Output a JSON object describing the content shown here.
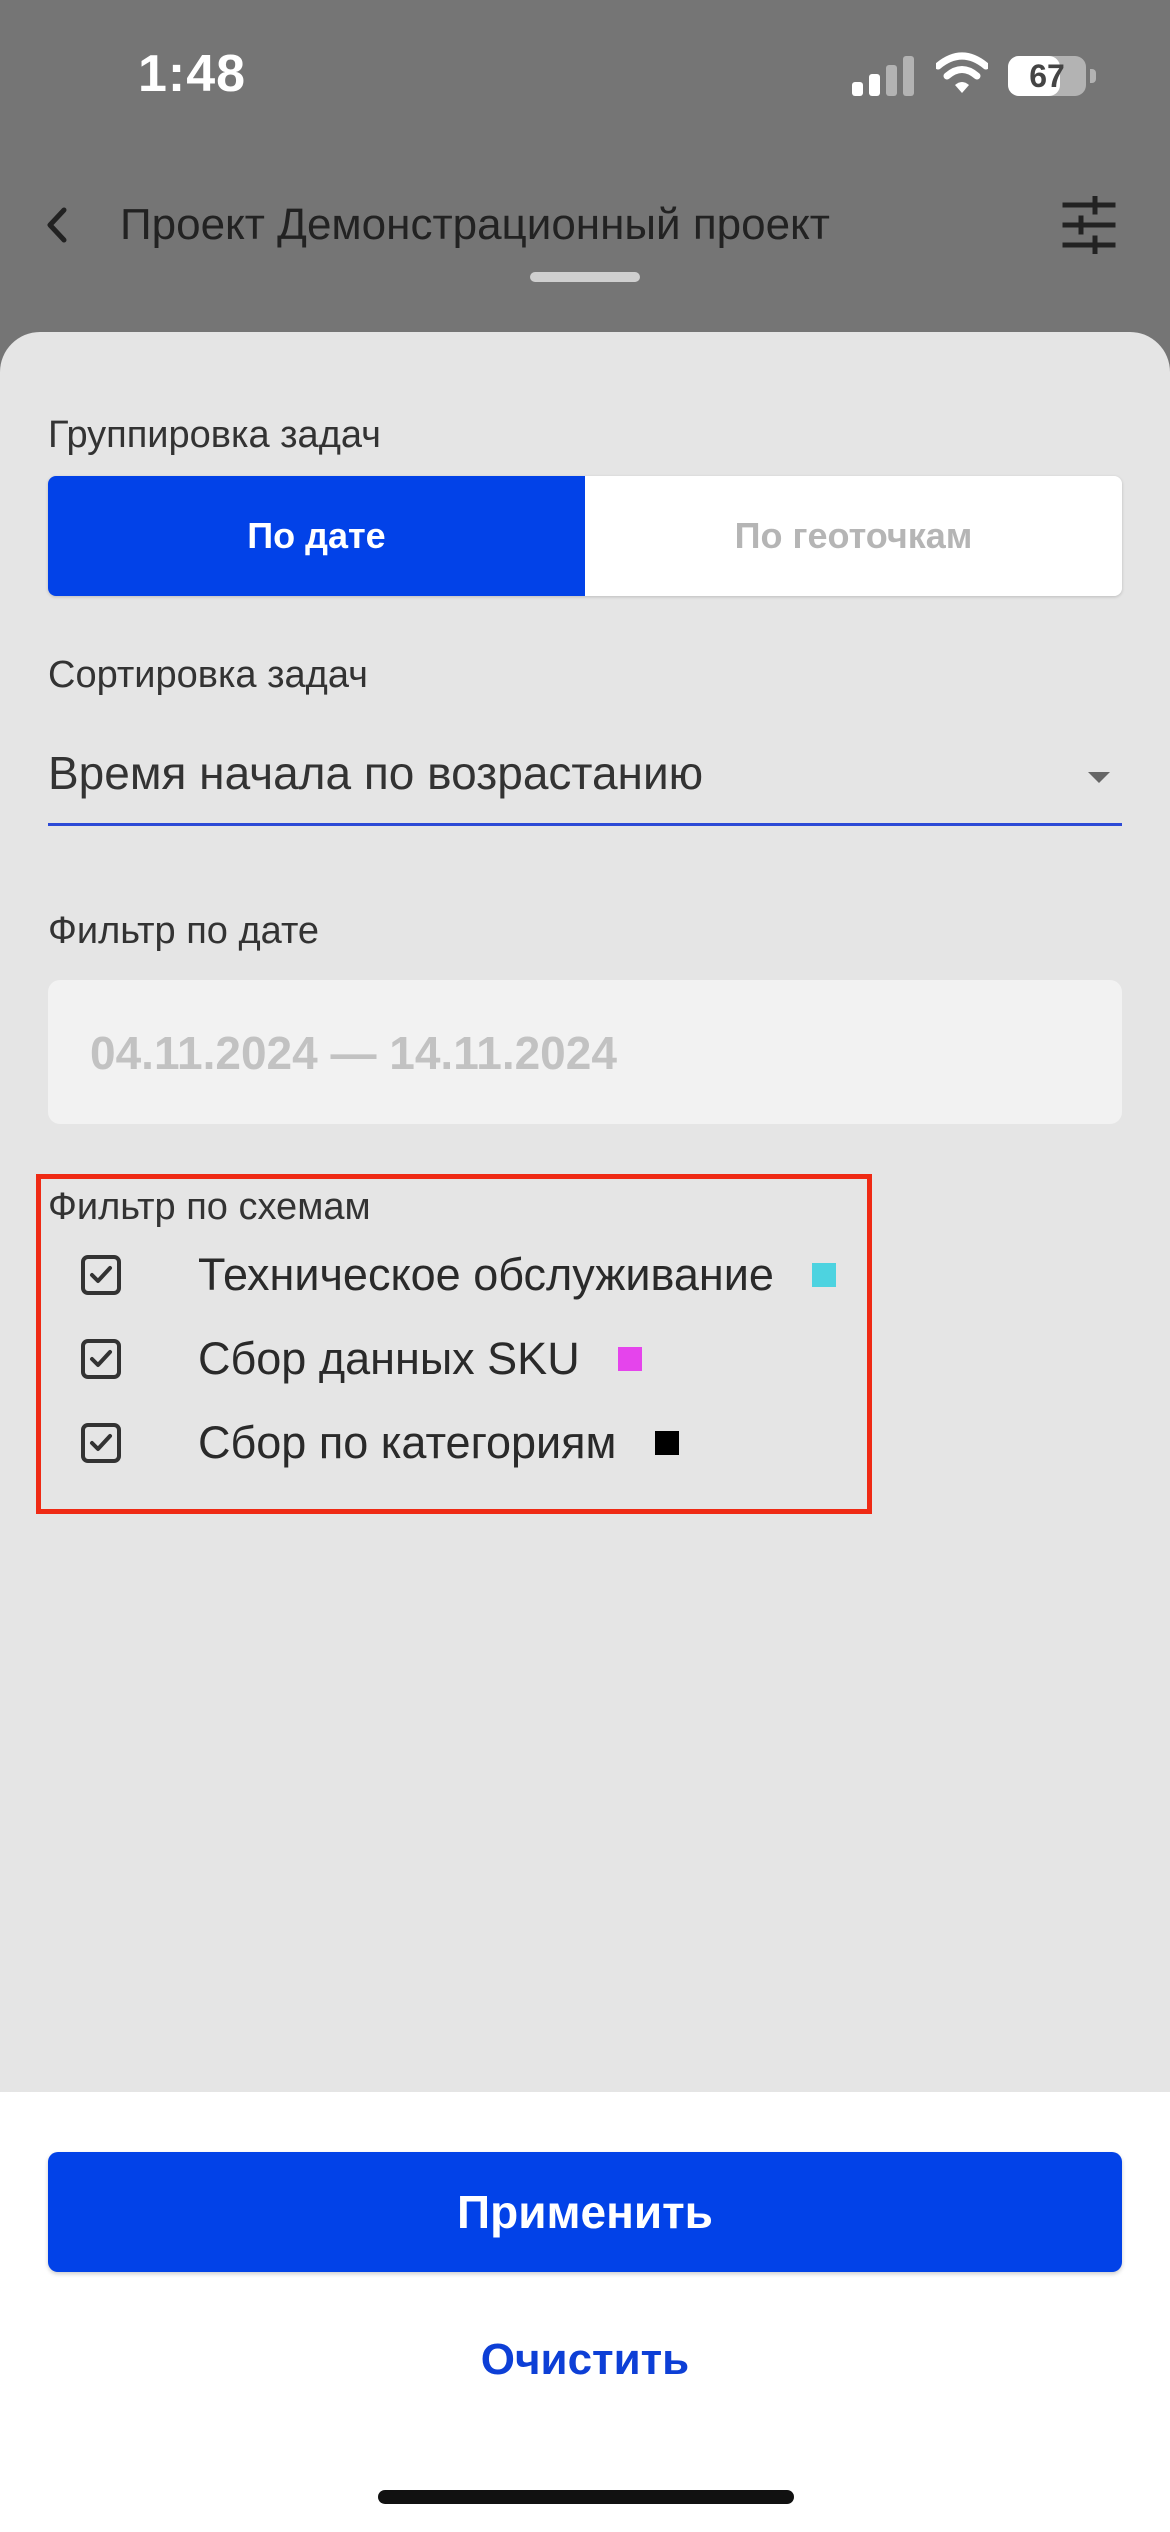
{
  "status_bar": {
    "time": "1:48",
    "battery": "67"
  },
  "header": {
    "title": "Проект Демонстрационный проект",
    "back_icon": "chevron-left-icon",
    "settings_icon": "sliders-icon"
  },
  "grouping": {
    "label": "Группировка задач",
    "options": [
      {
        "label": "По дате",
        "selected": true
      },
      {
        "label": "По геоточкам",
        "selected": false
      }
    ]
  },
  "sorting": {
    "label": "Сортировка задач",
    "value": "Время начала по возрастанию"
  },
  "date_filter": {
    "label": "Фильтр по дате",
    "value": "04.11.2024 — 14.11.2024"
  },
  "scheme_filter": {
    "label": "Фильтр по схемам",
    "items": [
      {
        "label": "Техническое обслуживание",
        "checked": true,
        "color": "#4dd3e0"
      },
      {
        "label": "Сбор данных SKU",
        "checked": true,
        "color": "#e544ec"
      },
      {
        "label": "Сбор по категориям",
        "checked": true,
        "color": "#000000"
      }
    ]
  },
  "actions": {
    "apply": "Применить",
    "clear": "Очистить"
  },
  "colors": {
    "primary": "#0242e8",
    "highlight": "#ef2a14"
  }
}
